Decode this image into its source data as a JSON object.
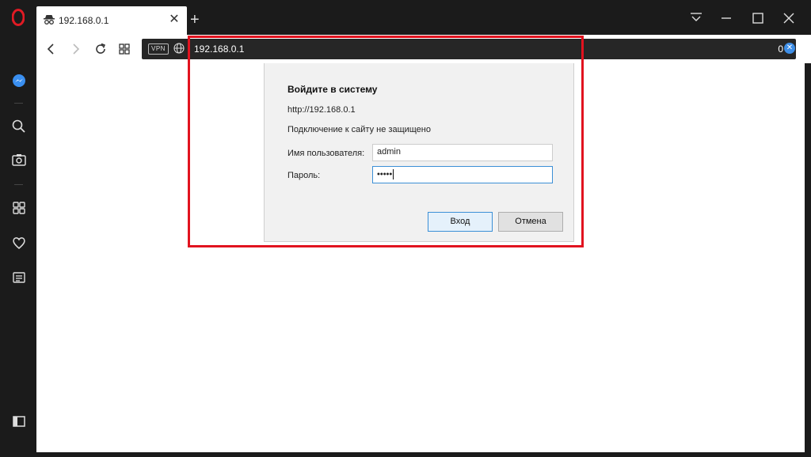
{
  "tab": {
    "title": "192.168.0.1",
    "icon": "incognito-icon"
  },
  "address_bar": {
    "vpn_label": "VPN",
    "url": "192.168.0.1",
    "blocked_count": "0"
  },
  "dialog": {
    "title": "Войдите в систему",
    "site": "http://192.168.0.1",
    "warning": "Подключение к сайту не защищено",
    "username_label": "Имя пользователя:",
    "username_value": "admin",
    "password_label": "Пароль:",
    "password_value": "•••••",
    "login_label": "Вход",
    "cancel_label": "Отмена"
  },
  "colors": {
    "highlight": "#e1131f",
    "brand": "#e01b24",
    "sidebar": "#1b1b1b",
    "focus": "#3b8fd6"
  },
  "sidebar": {
    "items": [
      "messenger-icon",
      "search-icon",
      "camera-icon",
      "speed-dial-icon",
      "heart-icon",
      "news-icon",
      "sidebar-toggle-icon"
    ]
  }
}
